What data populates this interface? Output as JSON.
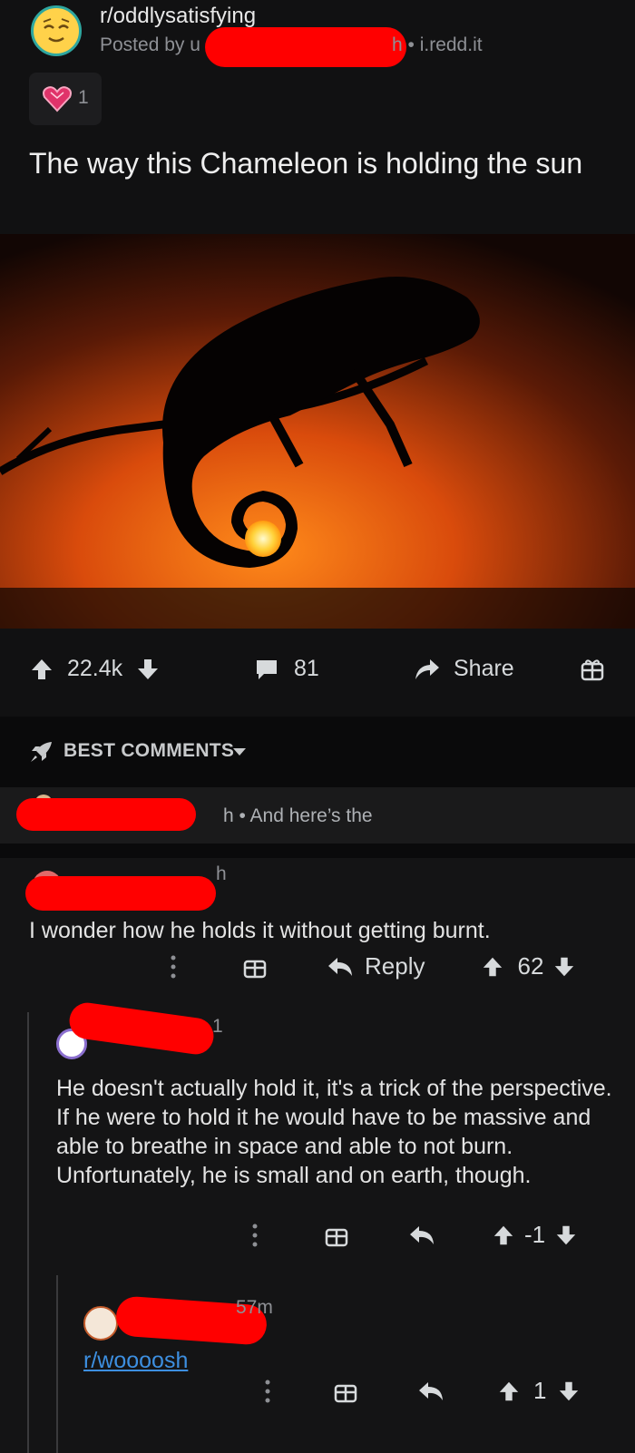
{
  "post": {
    "subreddit": "r/oddlysatisfying",
    "posted_by_prefix": "Posted by u",
    "time_domain": "h • i.redd.it",
    "award_count": "1",
    "title": "The way this Chameleon is holding the sun"
  },
  "actions": {
    "score": "22.4k",
    "comments": "81",
    "share": "Share"
  },
  "sort": {
    "label": "BEST COMMENTS"
  },
  "collapsed": {
    "text": "h • And here’s the"
  },
  "comments": [
    {
      "time": "h",
      "body": "I wonder how he holds it without getting burnt.",
      "reply_label": "Reply",
      "score": "62"
    },
    {
      "time": "1",
      "body": "He doesn't actually hold it, it's a trick of the perspective. If he were to hold it he would have to be massive and able to breathe in space and able to not burn. Unfortunately, he is small and on earth, though.",
      "score": "-1"
    },
    {
      "time": "57m",
      "link": "r/woooosh",
      "score": "1"
    }
  ],
  "colors": {
    "background": "#111112",
    "link": "#3d8fe0",
    "redaction": "#ff0000"
  }
}
